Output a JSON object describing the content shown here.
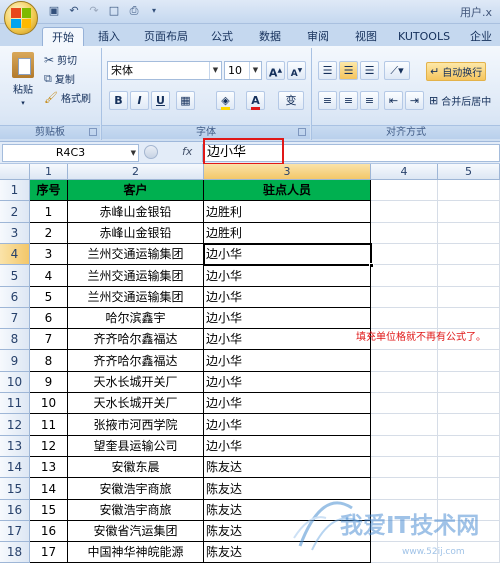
{
  "window": {
    "title_fragment": "用户.x"
  },
  "tabs": [
    "开始",
    "插入",
    "页面布局",
    "公式",
    "数据",
    "审阅",
    "视图",
    "KUTOOLS",
    "企业"
  ],
  "clipboard": {
    "paste": "粘贴",
    "cut": "剪切",
    "copy": "复制",
    "format_painter": "格式刷",
    "group": "剪贴板"
  },
  "font": {
    "name": "宋体",
    "size": "10",
    "bold": "B",
    "italic": "I",
    "underline": "U",
    "grow": "A",
    "shrink": "A",
    "group": "字体",
    "wen": "变"
  },
  "alignment": {
    "wrap": "自动换行",
    "merge": "合并后居中",
    "group": "对齐方式"
  },
  "formula_bar": {
    "name_box": "R4C3",
    "fx": "fx",
    "content": "边小华"
  },
  "columns": [
    "1",
    "2",
    "3",
    "4",
    "5"
  ],
  "rows": [
    "1",
    "2",
    "3",
    "4",
    "5",
    "6",
    "7",
    "8",
    "9",
    "10",
    "11",
    "12",
    "13",
    "14",
    "15",
    "16",
    "17",
    "18"
  ],
  "table": {
    "headers": [
      "序号",
      "客户",
      "驻点人员"
    ],
    "rows": [
      [
        "1",
        "赤峰山金银铅",
        "边胜利"
      ],
      [
        "2",
        "赤峰山金银铅",
        "边胜利"
      ],
      [
        "3",
        "兰州交通运输集团",
        "边小华"
      ],
      [
        "4",
        "兰州交通运输集团",
        "边小华"
      ],
      [
        "5",
        "兰州交通运输集团",
        "边小华"
      ],
      [
        "6",
        "哈尔滨鑫宇",
        "边小华"
      ],
      [
        "7",
        "齐齐哈尔鑫福达",
        "边小华"
      ],
      [
        "8",
        "齐齐哈尔鑫福达",
        "边小华"
      ],
      [
        "9",
        "天水长城开关厂",
        "边小华"
      ],
      [
        "10",
        "天水长城开关厂",
        "边小华"
      ],
      [
        "11",
        "张掖市河西学院",
        "边小华"
      ],
      [
        "12",
        "望奎县运输公司",
        "边小华"
      ],
      [
        "13",
        "安徽东晨",
        "陈友达"
      ],
      [
        "14",
        "安徽浩宇商旅",
        "陈友达"
      ],
      [
        "15",
        "安徽浩宇商旅",
        "陈友达"
      ],
      [
        "16",
        "安徽省汽运集团",
        "陈友达"
      ],
      [
        "17",
        "中国神华神皖能源",
        "陈友达"
      ]
    ]
  },
  "annotation": "填充单位格就不再有公式了。",
  "watermark": {
    "text": "我爱IT技术网",
    "url": "www.52ij.com"
  },
  "colors": {
    "header_fill": "#00b050",
    "highlight": "#e01818",
    "selected_header": "#f3c769"
  }
}
